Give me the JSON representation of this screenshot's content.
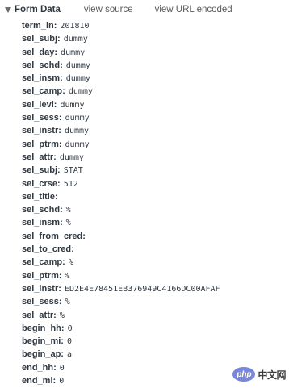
{
  "header": {
    "title": "Form Data",
    "view_source": "view source",
    "view_url_encoded": "view URL encoded"
  },
  "rows": [
    {
      "key": "term_in",
      "value": "201810"
    },
    {
      "key": "sel_subj",
      "value": "dummy"
    },
    {
      "key": "sel_day",
      "value": "dummy"
    },
    {
      "key": "sel_schd",
      "value": "dummy"
    },
    {
      "key": "sel_insm",
      "value": "dummy"
    },
    {
      "key": "sel_camp",
      "value": "dummy"
    },
    {
      "key": "sel_levl",
      "value": "dummy"
    },
    {
      "key": "sel_sess",
      "value": "dummy"
    },
    {
      "key": "sel_instr",
      "value": "dummy"
    },
    {
      "key": "sel_ptrm",
      "value": "dummy"
    },
    {
      "key": "sel_attr",
      "value": "dummy"
    },
    {
      "key": "sel_subj",
      "value": "STAT"
    },
    {
      "key": "sel_crse",
      "value": "512"
    },
    {
      "key": "sel_title",
      "value": ""
    },
    {
      "key": "sel_schd",
      "value": "%"
    },
    {
      "key": "sel_insm",
      "value": "%"
    },
    {
      "key": "sel_from_cred",
      "value": ""
    },
    {
      "key": "sel_to_cred",
      "value": ""
    },
    {
      "key": "sel_camp",
      "value": "%"
    },
    {
      "key": "sel_ptrm",
      "value": "%"
    },
    {
      "key": "sel_instr",
      "value": "ED2E4E78451EB376949C4166DC00AFAF"
    },
    {
      "key": "sel_sess",
      "value": "%"
    },
    {
      "key": "sel_attr",
      "value": "%"
    },
    {
      "key": "begin_hh",
      "value": "0"
    },
    {
      "key": "begin_mi",
      "value": "0"
    },
    {
      "key": "begin_ap",
      "value": "a"
    },
    {
      "key": "end_hh",
      "value": "0"
    },
    {
      "key": "end_mi",
      "value": "0"
    }
  ],
  "watermark": {
    "logo": "php",
    "text": "中文网"
  }
}
